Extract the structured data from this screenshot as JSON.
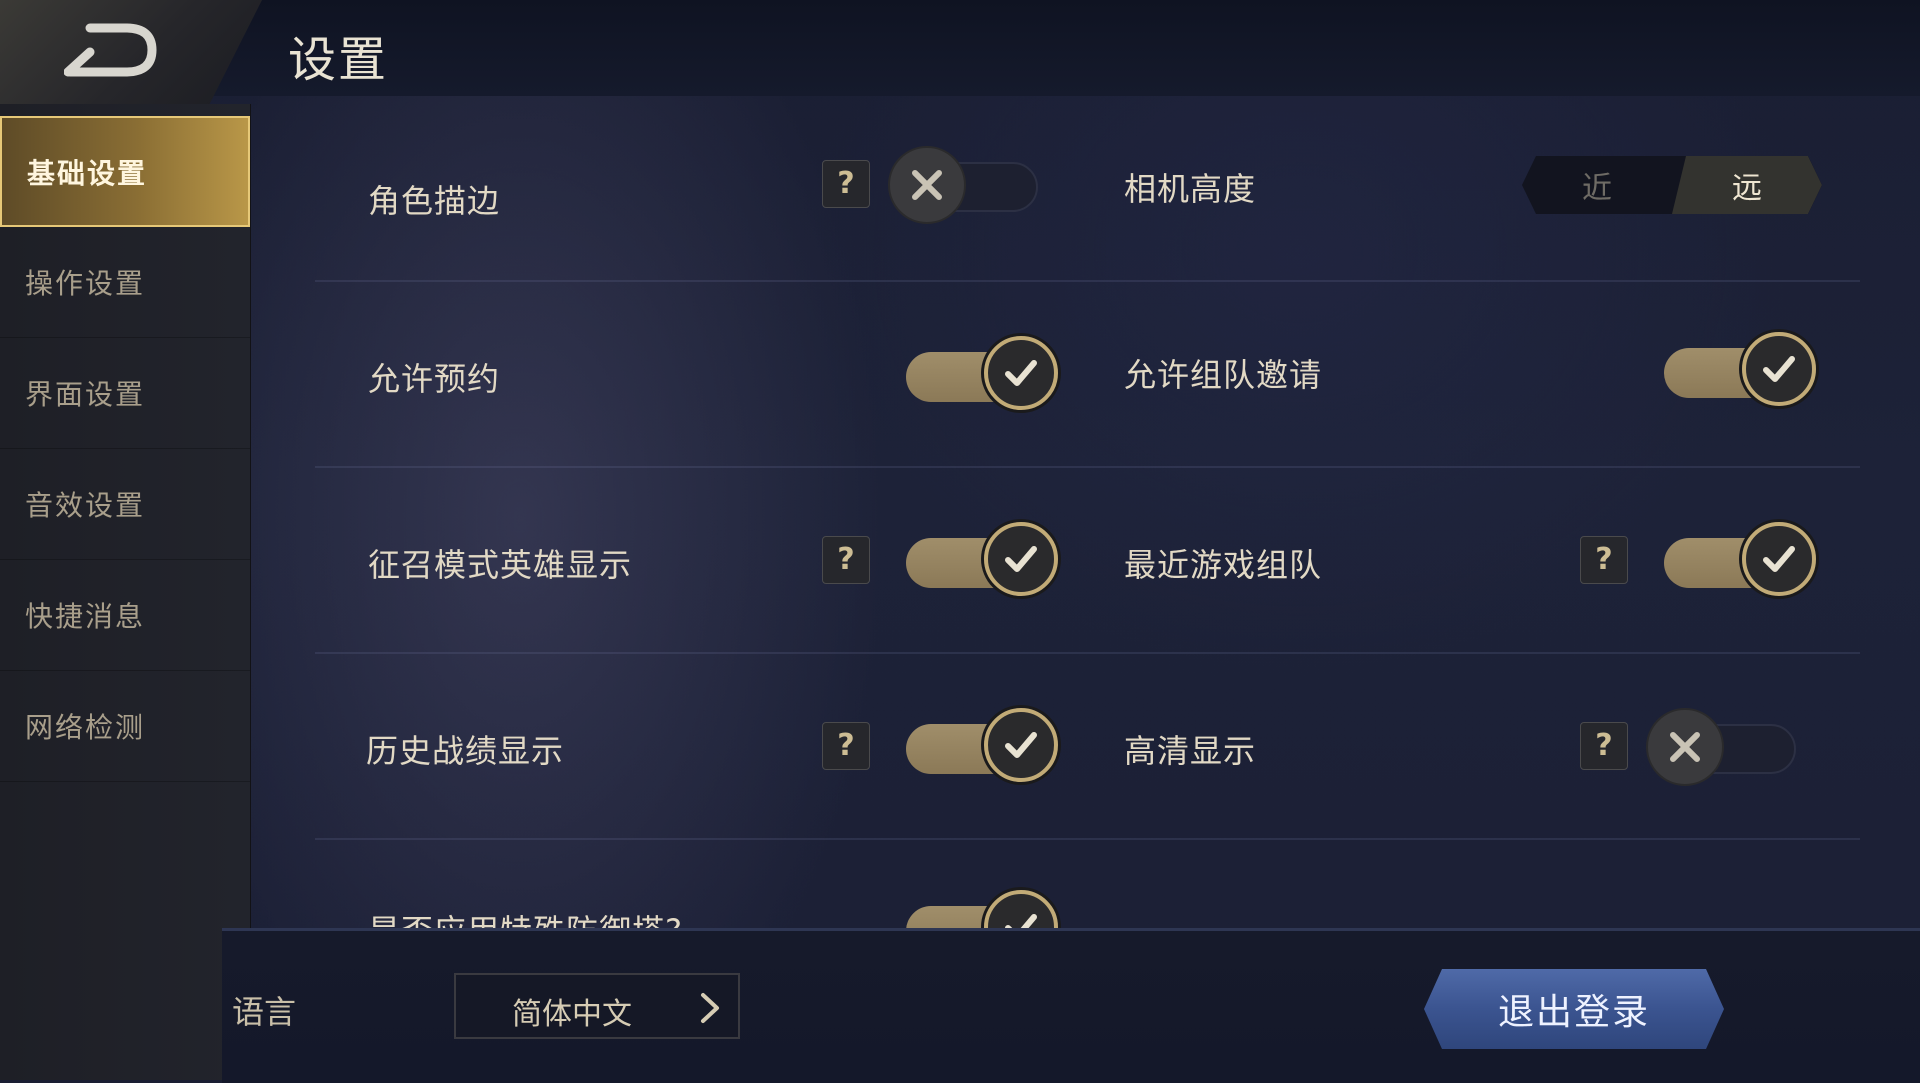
{
  "header": {
    "title": "设置",
    "back_icon": "back-arrow-icon"
  },
  "sidebar": {
    "items": [
      {
        "label": "基础设置",
        "active": true
      },
      {
        "label": "操作设置",
        "active": false
      },
      {
        "label": "界面设置",
        "active": false
      },
      {
        "label": "音效设置",
        "active": false
      },
      {
        "label": "快捷消息",
        "active": false
      },
      {
        "label": "网络检测",
        "active": false
      }
    ]
  },
  "settings": {
    "role_outline": {
      "label": "角色描边",
      "help": "?",
      "enabled": false
    },
    "camera_height": {
      "label": "相机高度",
      "options": [
        "近",
        "远"
      ],
      "selected": "远"
    },
    "allow_reservation": {
      "label": "允许预约",
      "enabled": true
    },
    "allow_team_invite": {
      "label": "允许组队邀请",
      "enabled": true
    },
    "recruit_hero_display": {
      "label": "征召模式英雄显示",
      "help": "?",
      "enabled": true
    },
    "recent_game_team": {
      "label": "最近游戏组队",
      "help": "?",
      "enabled": true
    },
    "history_record_display": {
      "label": "历史战绩显示",
      "help": "?",
      "enabled": true
    },
    "hd_display": {
      "label": "高清显示",
      "help": "?",
      "enabled": false
    },
    "partial_row": {
      "label": "是否应用特殊防御塔?",
      "enabled": true
    }
  },
  "footer": {
    "language_label": "语言",
    "language_value": "简体中文",
    "logout_label": "退出登录"
  },
  "colors": {
    "accent_gold": "#c2ab77",
    "logout_blue": "#3b5490"
  }
}
